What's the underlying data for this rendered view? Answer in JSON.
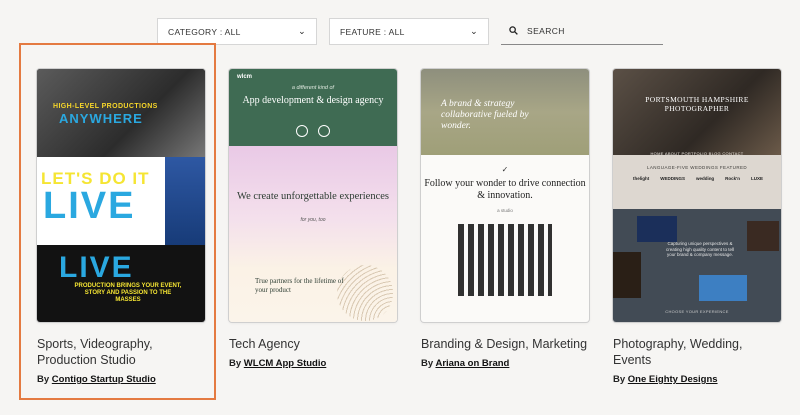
{
  "filters": {
    "category": {
      "label": "CATEGORY : All"
    },
    "feature": {
      "label": "FEATURE : All"
    },
    "search": {
      "placeholder": "SEARCH"
    }
  },
  "accent": "#e47a41",
  "cards": [
    {
      "title_line1": "Sports, Videography,",
      "title_line2": "Production Studio",
      "by": "By",
      "author": "Contigo Startup Studio",
      "thumb": {
        "line1": "HIGH-LEVEL PRODUCTIONS",
        "line2": "ANYWHERE",
        "line3": "LET'S DO IT",
        "line4": "LIVE",
        "line5": "LIVE",
        "line6": "PRODUCTION BRINGS YOUR EVENT, STORY AND PASSION TO THE MASSES"
      }
    },
    {
      "title": "Tech Agency",
      "by": "By",
      "author": "WLCM App Studio",
      "thumb": {
        "logo": "wlcm",
        "kicker": "a different kind of",
        "heading": "App development & design agency",
        "heading2": "We create unforgettable experiences",
        "heading2_sub": "for you, too",
        "para": "True partners for the lifetime of your product"
      }
    },
    {
      "title": "Branding & Design, Marketing",
      "by": "By",
      "author": "Ariana on Brand",
      "thumb": {
        "heading": "A brand & strategy collaborative fueled by wonder.",
        "mark": "✓",
        "heading2": "Follow your wonder to drive connection & innovation.",
        "small": "a studio"
      }
    },
    {
      "title": "Photography, Wedding, Events",
      "by": "By",
      "author": "One Eighty Designs",
      "thumb": {
        "title": "PORTSMOUTH HAMPSHIRE PHOTOGRAPHER",
        "nav": "HOME   ABOUT   PORTFOLIO   BLOG   CONTACT",
        "sub": "LANGUAGE-FIVE WEDDINGS FEATURED",
        "logos": [
          "thelight",
          "WEDDINGS",
          "wedding",
          "Rock'n",
          "LUXE"
        ],
        "panel_text": "Capturing unique perspectives & creating high quality content to tell your brand & company message.",
        "foot": "CHOOSE YOUR EXPERIENCE"
      }
    }
  ]
}
